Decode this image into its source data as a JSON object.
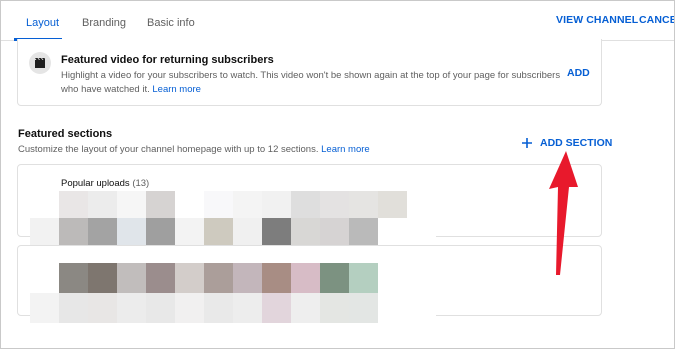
{
  "tabs": [
    {
      "label": "Layout",
      "active": true
    },
    {
      "label": "Branding",
      "active": false
    },
    {
      "label": "Basic info",
      "active": false
    }
  ],
  "header_actions": {
    "view_channel": "VIEW CHANNEL",
    "cancel": "CANCEL"
  },
  "featured_video": {
    "icon": "film-icon",
    "title": "Featured video for returning subscribers",
    "description": "Highlight a video for your subscribers to watch. This video won't be shown again at the top of your page for subscribers who have watched it.",
    "learn_more": "Learn more",
    "add_label": "ADD"
  },
  "featured_sections": {
    "title": "Featured sections",
    "description": "Customize the layout of your channel homepage with up to 12 sections.",
    "learn_more": "Learn more",
    "add_section_label": "ADD SECTION",
    "add_icon": "plus-icon"
  },
  "sections": [
    {
      "title": "Popular uploads",
      "count": "(13)",
      "drag_icon": "drag-handle-icon",
      "thumb_colors": [
        "#ffffff",
        "#e9e6e6",
        "#ececec",
        "#f6f6f6",
        "#d6d3d2",
        "#ffffff",
        "#f8f8fa",
        "#f4f4f4",
        "#f1f1f1",
        "#dedede",
        "#e4e2e2",
        "#e5e4e2",
        "#e1dfda",
        "#ffffff",
        "#f2f2f2",
        "#bcbab9",
        "#a3a3a3",
        "#e0e5ea",
        "#9f9f9f",
        "#f3f3f3",
        "#cecabf",
        "#f0f0f0",
        "#7d7d7d",
        "#d8d7d5",
        "#d6d3d3",
        "#bababa",
        "#ffffff",
        "#ffffff",
        "#ffffff",
        "#f1f1f1",
        "#f2f2f2",
        "#ffffff",
        "#ffffff",
        "#ffffff",
        "#ffffff",
        "#ffffff",
        "#ffffff",
        "#ffffff",
        "#ffffff",
        "#ffffff",
        "#ffffff",
        "#ffffff"
      ]
    },
    {
      "drag_icon": "drag-handle-icon",
      "thumb_colors": [
        "#ffffff",
        "#8b8883",
        "#7e766f",
        "#c1bdbc",
        "#9b8d8d",
        "#d3cdca",
        "#ab9e9a",
        "#c3b6bb",
        "#a88d84",
        "#d7bcc6",
        "#7c9281",
        "#b4cfc0",
        "#ffffff",
        "#ffffff",
        "#f3f3f3",
        "#e7e7e7",
        "#e8e6e5",
        "#ececec",
        "#e8e8e8",
        "#f1f0f0",
        "#e9e9e9",
        "#ededed",
        "#e2d5dc",
        "#eeeeee",
        "#e4e6e3",
        "#e3e6e4",
        "#ffffff",
        "#ffffff"
      ]
    }
  ],
  "accent_colors": {
    "link": "#065fd4",
    "annotation_arrow": "#e8192c"
  }
}
